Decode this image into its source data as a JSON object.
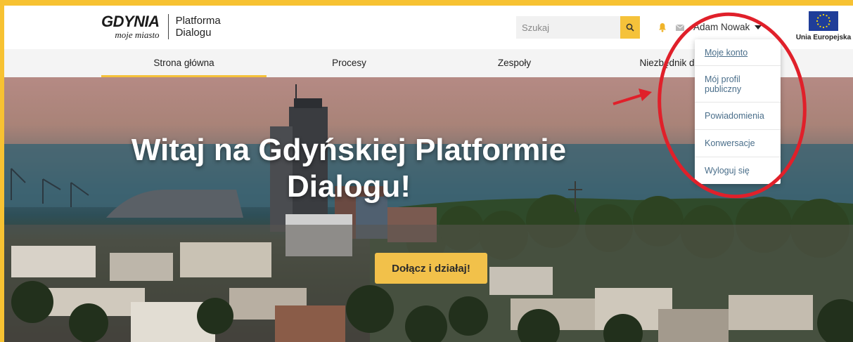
{
  "header": {
    "logo_main": "GDYNIA",
    "logo_sub": "moje miasto",
    "platform_line1": "Platforma",
    "platform_line2": "Dialogu",
    "search_placeholder": "Szukaj",
    "user_name": "Adam Nowak",
    "eu_label": "Unia Europejska"
  },
  "nav": {
    "items": [
      {
        "label": "Strona główna",
        "active": true
      },
      {
        "label": "Procesy"
      },
      {
        "label": "Zespoły"
      },
      {
        "label": "Niezbędnik dialogu"
      }
    ]
  },
  "hero": {
    "title_line1": "Witaj na Gdyńskiej Platformie",
    "title_line2": "Dialogu!",
    "cta_label": "Dołącz i działaj!"
  },
  "user_dropdown": {
    "items": [
      {
        "label": "Moje konto"
      },
      {
        "label": "Mój profil publiczny"
      },
      {
        "label": "Powiadomienia"
      },
      {
        "label": "Konwersacje"
      },
      {
        "label": "Wyloguj się"
      }
    ]
  },
  "colors": {
    "frame_border": "#f7c232",
    "accent": "#f5c23a",
    "link": "#4a6e8a",
    "annotation_red": "#e0202a"
  }
}
